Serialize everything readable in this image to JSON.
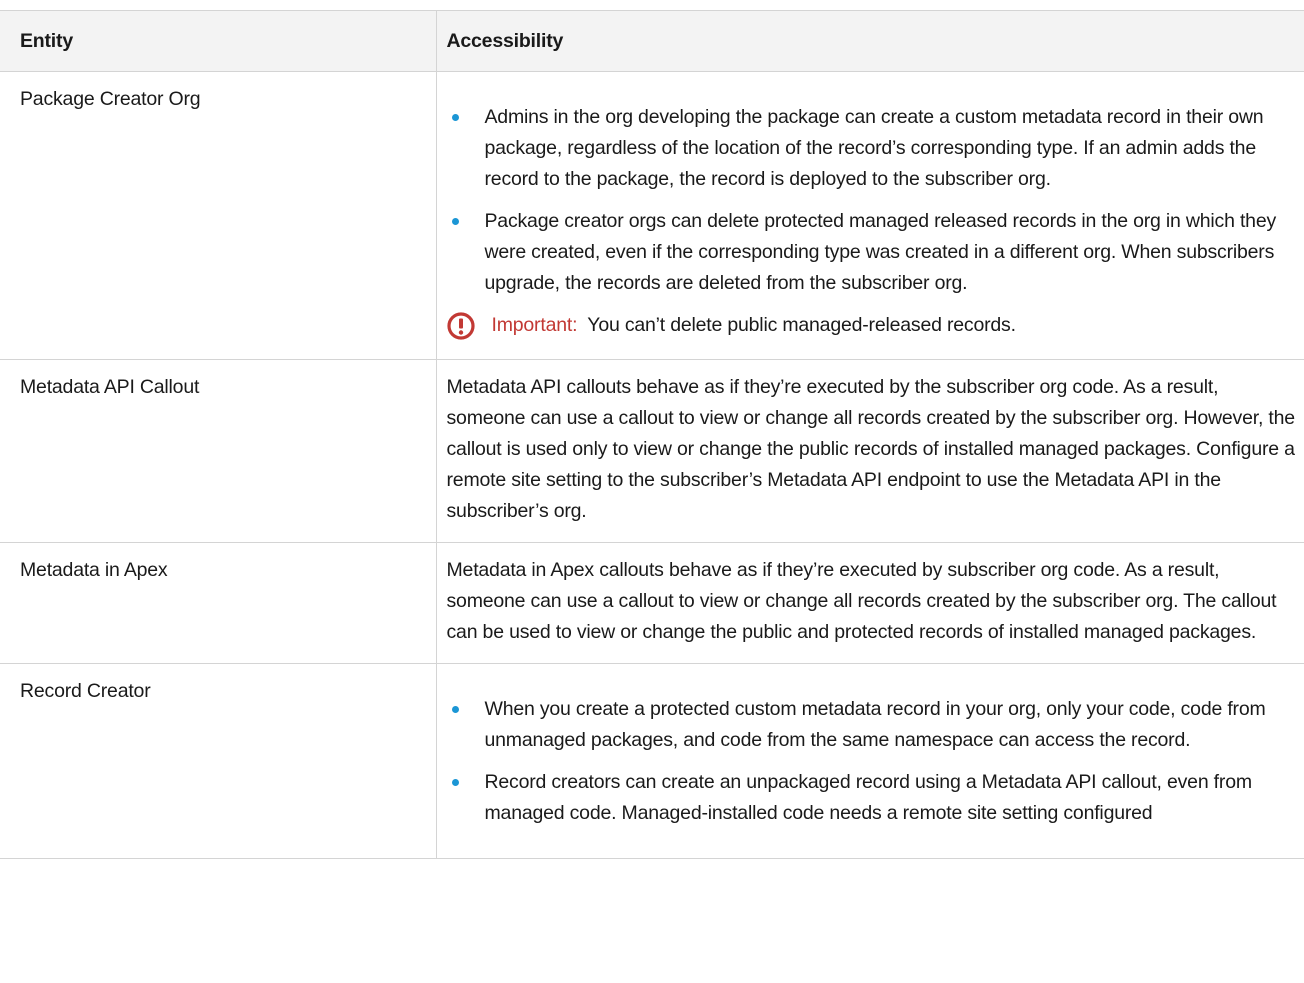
{
  "table": {
    "headers": {
      "entity": "Entity",
      "accessibility": "Accessibility"
    },
    "rows": [
      {
        "entity": "Package Creator Org",
        "bullets": [
          "Admins in the org developing the package can create a custom metadata record in their own package, regardless of the location of the record’s corresponding type. If an admin adds the record to the package, the record is deployed to the subscriber org.",
          "Package creator orgs can delete protected managed released records in the org in which they were created, even if the corresponding type was created in a different org. When subscribers upgrade, the records are deleted from the subscriber org."
        ],
        "important": {
          "icon": "warning-icon",
          "label": "Important:",
          "text": "You can’t delete public managed-released records."
        }
      },
      {
        "entity": "Metadata API Callout",
        "text": "Metadata API callouts behave as if they’re executed by the subscriber org code. As a result, someone can use a callout to view or change all records created by the subscriber org. However, the callout is used only to view or change the public records of installed managed packages. Configure a remote site setting to the subscriber’s Metadata API endpoint to use the Metadata API in the subscriber’s org."
      },
      {
        "entity": "Metadata in Apex",
        "text": "Metadata in Apex callouts behave as if they’re executed by subscriber org code. As a result, someone can use a callout to view or change all records created by the subscriber org. The callout can be used to view or change the public and protected records of installed managed packages."
      },
      {
        "entity": "Record Creator",
        "bullets": [
          "When you create a protected custom metadata record in your org, only your code, code from unmanaged packages, and code from the same namespace can access the record.",
          "Record creators can create an unpackaged record using a Metadata API callout, even from managed code. Managed-installed code needs a remote site setting configured"
        ]
      }
    ]
  },
  "colors": {
    "bullet": "#1b96d5",
    "important": "#c23934",
    "header_bg": "#f3f3f3",
    "border": "#d4d4d4"
  }
}
